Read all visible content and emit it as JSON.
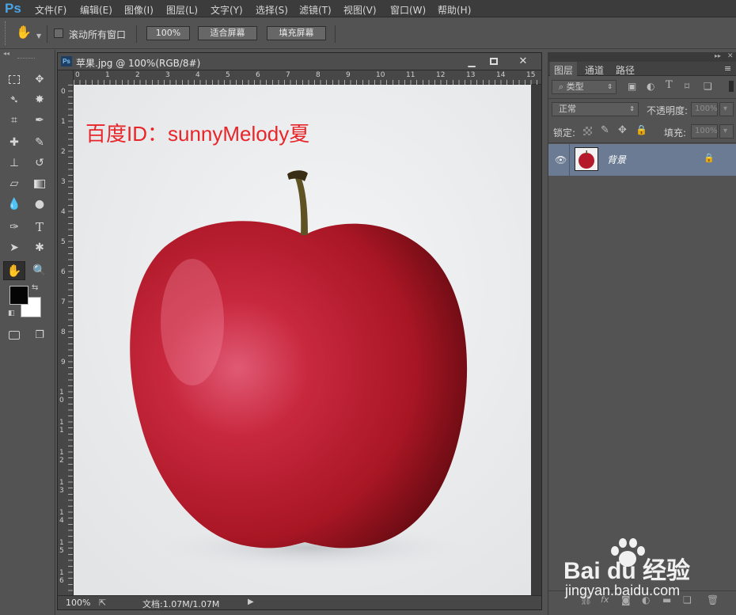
{
  "app": {
    "logo": "Ps"
  },
  "menu": [
    "文件(F)",
    "编辑(E)",
    "图像(I)",
    "图层(L)",
    "文字(Y)",
    "选择(S)",
    "滤镜(T)",
    "视图(V)",
    "窗口(W)",
    "帮助(H)"
  ],
  "options": {
    "scroll_all": "滚动所有窗口",
    "zoom_100": "100%",
    "fit_screen": "适合屏幕",
    "fill_screen": "填充屏幕"
  },
  "document": {
    "title": "苹果.jpg @ 100%(RGB/8#)",
    "watermark": "百度ID：sunnyMelody夏",
    "ruler_top": [
      "0",
      "1",
      "2",
      "3",
      "4",
      "5",
      "6",
      "7",
      "8",
      "9",
      "10",
      "11",
      "12",
      "13",
      "14",
      "15"
    ],
    "ruler_left": [
      "0",
      "1",
      "2",
      "3",
      "4",
      "5",
      "6",
      "7",
      "8",
      "9",
      "10",
      "11",
      "12",
      "13",
      "14",
      "15",
      "16"
    ],
    "status_zoom": "100%",
    "status_doc": "文档:1.07M/1.07M"
  },
  "layers_panel": {
    "tabs": [
      "图层",
      "通道",
      "路径"
    ],
    "filter_kind": "类型",
    "blend_mode": "正常",
    "opacity_label": "不透明度:",
    "opacity_value": "100%",
    "lock_label": "锁定:",
    "fill_label": "填充:",
    "fill_value": "100%",
    "layer_name": "背景"
  },
  "watermark_bottom": {
    "logo": "Bai du 经验",
    "url": "jingyan.baidu.com"
  },
  "colors": {
    "accent_blue": "#4aa4e6",
    "watermark_red": "#e8262a",
    "layer_selected": "#6b7b93"
  }
}
